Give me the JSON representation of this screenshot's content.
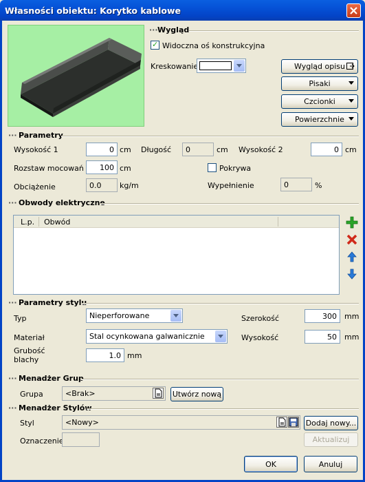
{
  "window": {
    "title": "Własności obiektu: Korytko kablowe"
  },
  "sections": {
    "wyglad": "Wygląd",
    "parametry": "Parametry",
    "obwody": "Obwody elektryczne",
    "parametry_stylu": "Parametry stylu",
    "menadzer_grup": "Menadżer Grup",
    "menadzer_stylow": "Menadżer Stylów"
  },
  "wyglad": {
    "visible_axis_label": "Widoczna oś konstrukcyjna",
    "visible_axis_checked": true,
    "kreskowanie_label": "Kreskowanie",
    "wyglad_opisu_btn": "Wygląd opisu",
    "pisaki_btn": "Pisaki",
    "czcionki_btn": "Czcionki",
    "powierzchnie_btn": "Powierzchnie"
  },
  "parametry": {
    "wysokosc1": {
      "label": "Wysokość 1",
      "value": "0",
      "unit": "cm"
    },
    "dlugosc": {
      "label": "Długość",
      "value": "0",
      "unit": "cm"
    },
    "wysokosc2": {
      "label": "Wysokość 2",
      "value": "0",
      "unit": "cm"
    },
    "rozstaw": {
      "label": "Rozstaw mocowań",
      "value": "100",
      "unit": "cm"
    },
    "pokrywa": {
      "label": "Pokrywa",
      "checked": false
    },
    "obciazenie": {
      "label": "Obciążenie",
      "value": "0.0",
      "unit": "kg/m"
    },
    "wypelnienie": {
      "label": "Wypełnienie",
      "value": "0",
      "unit": "%"
    }
  },
  "obwody": {
    "columns": [
      "L.p.",
      "Obwód"
    ],
    "rows": [],
    "tools": [
      "add-icon",
      "delete-icon",
      "arrow-up-icon",
      "arrow-down-icon"
    ]
  },
  "parametry_stylu": {
    "typ": {
      "label": "Typ",
      "value": "Nieperforowane"
    },
    "material": {
      "label": "Materiał",
      "value": "Stal ocynkowana galwanicznie"
    },
    "grubosc": {
      "label_line1": "Grubość",
      "label_line2": "blachy",
      "value": "1.0",
      "unit": "mm"
    },
    "szerokosc": {
      "label": "Szerokość",
      "value": "300",
      "unit": "mm"
    },
    "wysokosc": {
      "label": "Wysokość",
      "value": "50",
      "unit": "mm"
    }
  },
  "grupy": {
    "grupa_label": "Grupa",
    "grupa_value": "<Brak>",
    "utworz_btn": "Utwórz nową"
  },
  "style": {
    "styl_label": "Styl",
    "styl_value": "<Nowy>",
    "dodaj_btn": "Dodaj nowy...",
    "oznaczenie_label": "Oznaczenie",
    "oznaczenie_value": "",
    "aktualizuj_btn": "Aktualizuj"
  },
  "footer": {
    "ok": "OK",
    "cancel": "Anuluj"
  },
  "colors": {
    "title_bar": "#0343c6",
    "dialog_bg": "#ece9d8",
    "preview_bg": "#a6efa4",
    "add_green": "#2aa52a",
    "delete_red": "#d02a1a",
    "arrow_blue": "#2a7ad8"
  }
}
